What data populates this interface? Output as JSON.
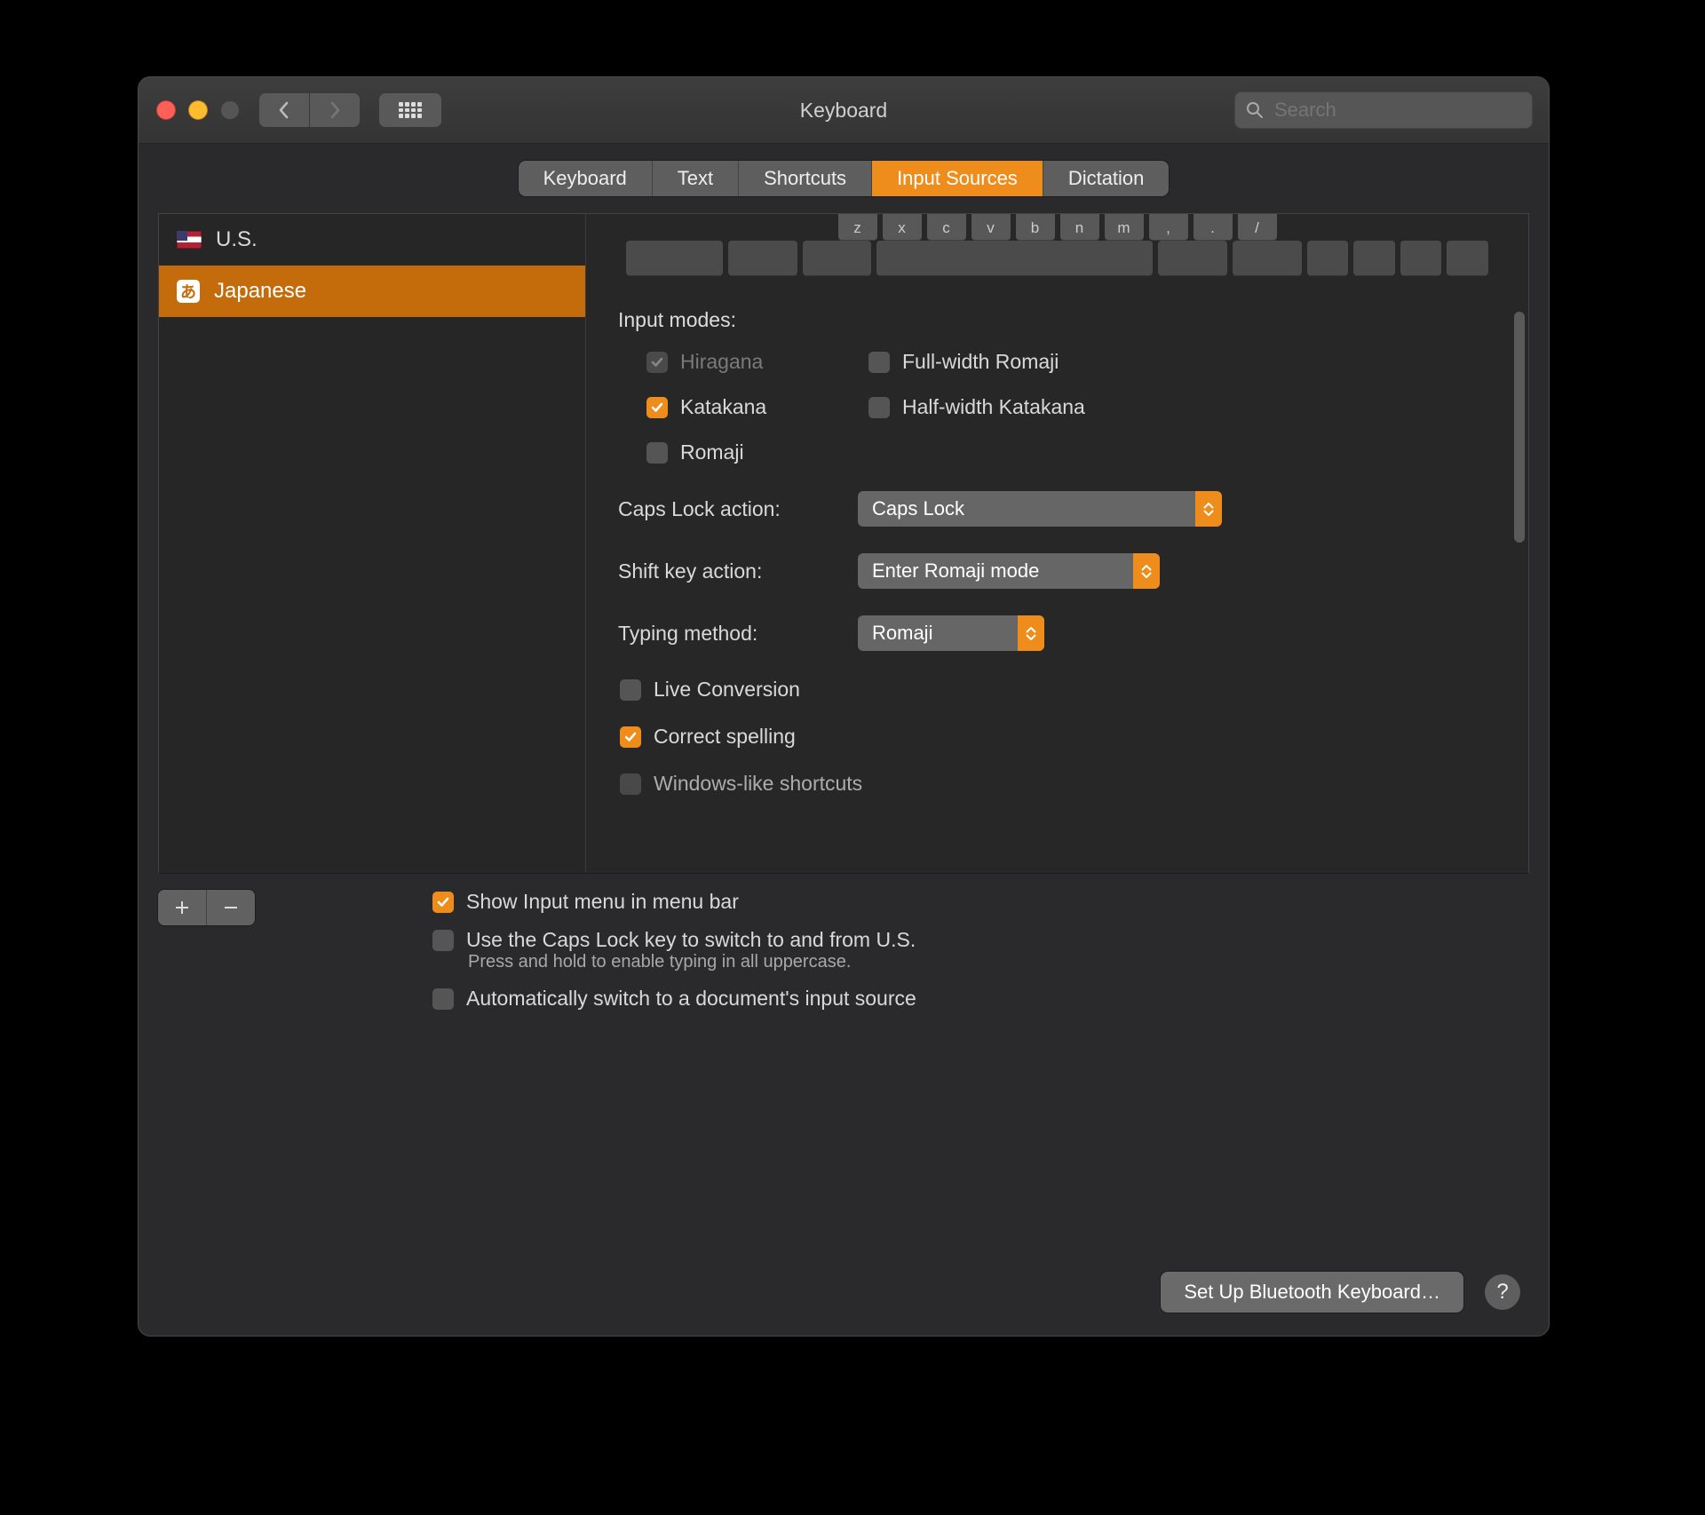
{
  "window": {
    "title": "Keyboard"
  },
  "search": {
    "placeholder": "Search"
  },
  "tabs": {
    "keyboard": "Keyboard",
    "text": "Text",
    "shortcuts": "Shortcuts",
    "input_sources": "Input Sources",
    "dictation": "Dictation",
    "active": "input_sources"
  },
  "sources": {
    "us": "U.S.",
    "japanese": "Japanese",
    "selected": "japanese"
  },
  "preview_keys": [
    "z",
    "x",
    "c",
    "v",
    "b",
    "n",
    "m",
    ",",
    ".",
    "/"
  ],
  "input_modes": {
    "heading": "Input modes:",
    "hiragana": {
      "label": "Hiragana",
      "checked": true,
      "disabled": true
    },
    "full_romaji": {
      "label": "Full-width Romaji",
      "checked": false
    },
    "katakana": {
      "label": "Katakana",
      "checked": true
    },
    "half_katakana": {
      "label": "Half-width Katakana",
      "checked": false
    },
    "romaji": {
      "label": "Romaji",
      "checked": false
    }
  },
  "caps_lock": {
    "label": "Caps Lock action:",
    "value": "Caps Lock"
  },
  "shift_key": {
    "label": "Shift key action:",
    "value": "Enter Romaji mode"
  },
  "typing_method": {
    "label": "Typing method:",
    "value": "Romaji"
  },
  "options": {
    "live_conversion": {
      "label": "Live Conversion",
      "checked": false
    },
    "correct_spelling": {
      "label": "Correct spelling",
      "checked": true
    },
    "windows_shortcuts": {
      "label": "Windows-like shortcuts",
      "checked": false
    }
  },
  "global": {
    "show_menu": {
      "label": "Show Input menu in menu bar",
      "checked": true
    },
    "caps_switch": {
      "label": "Use the Caps Lock key to switch to and from U.S.",
      "hint": "Press and hold to enable typing in all uppercase.",
      "checked": false
    },
    "auto_switch": {
      "label": "Automatically switch to a document's input source",
      "checked": false
    }
  },
  "footer": {
    "bluetooth": "Set Up Bluetooth Keyboard…"
  },
  "icons": {
    "jp_glyph": "あ"
  }
}
